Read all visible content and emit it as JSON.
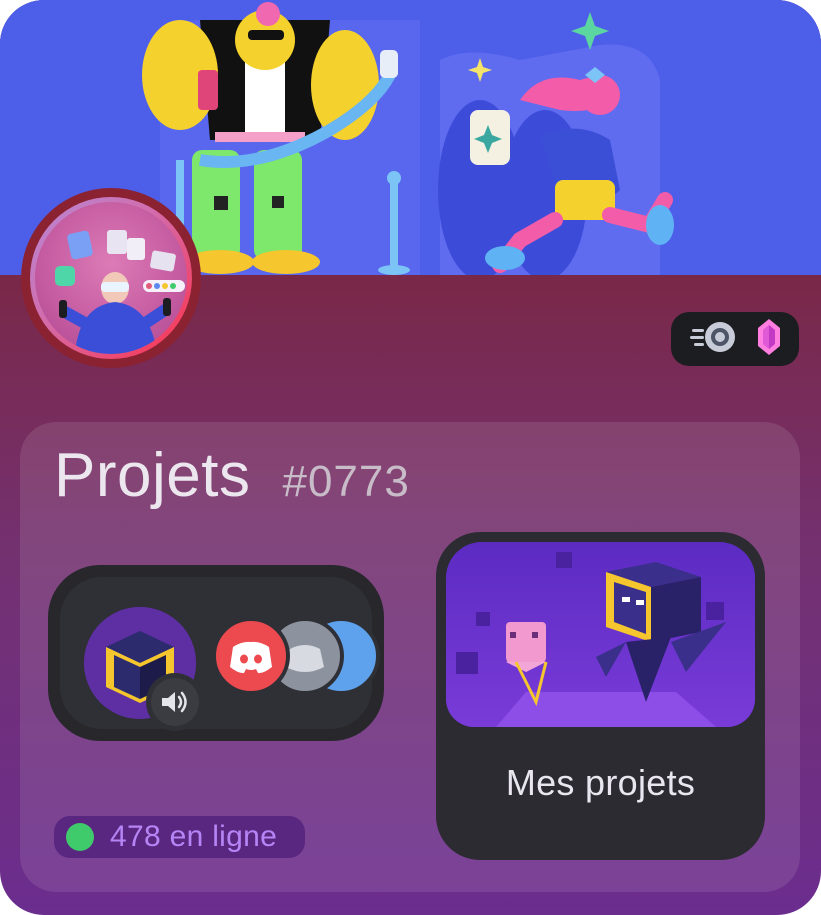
{
  "server": {
    "name": "Projets",
    "tag": "#0773",
    "online_label": "478 en ligne"
  },
  "badges": [
    "nitro-boost-icon",
    "gem-icon"
  ],
  "voice_channel": {
    "speaker_icon": "speaker-icon",
    "participants": [
      "discord-logo-red",
      "discord-logo-gray",
      "discord-logo-blue"
    ]
  },
  "project_card": {
    "label": "Mes projets"
  },
  "colors": {
    "banner": "#4d5ee8",
    "card_top": "#8b2232",
    "card_bottom": "#6b2d8e",
    "online_dot": "#3fca6b",
    "online_text": "#b685f5"
  }
}
